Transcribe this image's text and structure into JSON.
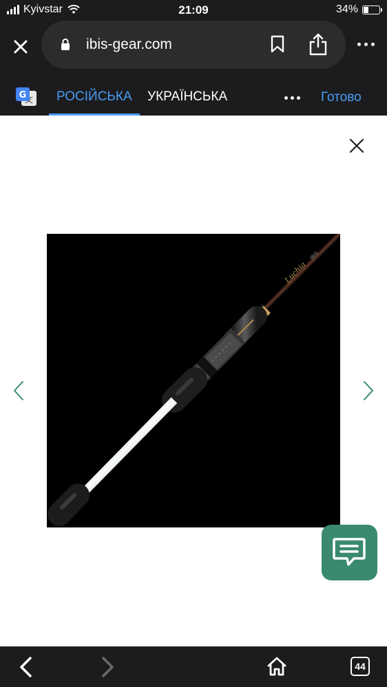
{
  "status_bar": {
    "carrier": "Kyivstar",
    "time": "21:09",
    "battery_text": "34%",
    "battery_level": 0.34
  },
  "browser": {
    "url": "ibis-gear.com"
  },
  "translate_bar": {
    "language_active": "РОСІЙСЬКА",
    "language_other": "УКРАЇНСЬКА",
    "done_label": "Готово"
  },
  "gallery": {
    "image_description": "fishing-rod-product-photo"
  },
  "bottom_bar": {
    "tab_count": "44"
  },
  "colors": {
    "accent": "#4a9cf5",
    "chat_button": "#3a8a6e",
    "dark_bar": "#1c1c1e",
    "urlbar": "#2c2c2e"
  }
}
